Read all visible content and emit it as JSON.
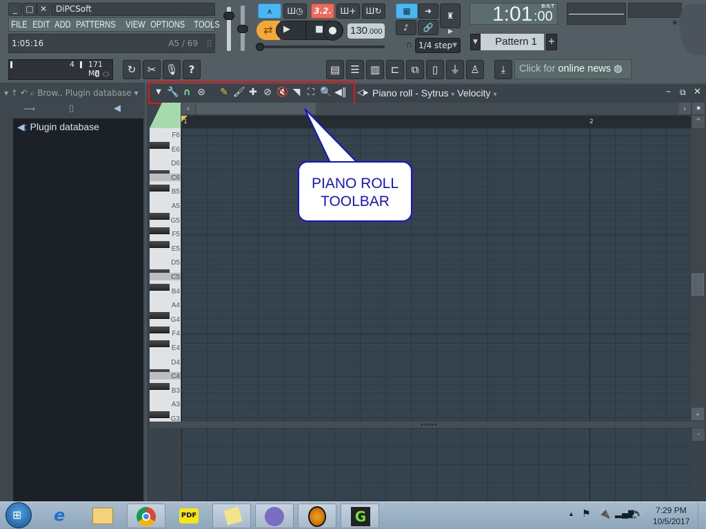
{
  "window": {
    "title": "DiPCSoft",
    "controls": [
      "minimize",
      "maximize",
      "close"
    ]
  },
  "menu": [
    "FILE",
    "EDIT",
    "ADD",
    "PATTERNS",
    "VIEW",
    "OPTIONS",
    "TOOLS",
    "?"
  ],
  "hint_bar": {
    "time": "1:05:16",
    "note_info": "A5 / 69"
  },
  "transport": {
    "song_position_mode": "3.2.",
    "tempo": "130",
    "tempo_decimal": ".000",
    "snap": "1/4 step",
    "pattern": "Pattern 1",
    "clock": {
      "main": "1:01",
      "sub": ":00",
      "format": "B:S:T"
    }
  },
  "system": {
    "cpu_value": "4",
    "memory": "171 MB",
    "polyphony": "0"
  },
  "news": {
    "prefix": "Click for",
    "link": "online news"
  },
  "browser": {
    "header_short": "Brow..",
    "header_title": "Plugin database",
    "items": [
      "Plugin database"
    ]
  },
  "piano_roll": {
    "title": "Piano roll - Sytrus",
    "target": "Velocity",
    "timeline_markers": [
      "1",
      "2"
    ],
    "keys": [
      {
        "label": "F6",
        "pos": 0
      },
      {
        "label": "E6",
        "pos": 1
      },
      {
        "label": "D6",
        "pos": 2
      },
      {
        "label": "C6",
        "pos": 3
      },
      {
        "label": "B5",
        "pos": 4
      },
      {
        "label": "A5",
        "pos": 5
      },
      {
        "label": "G5",
        "pos": 6
      },
      {
        "label": "F5",
        "pos": 7
      },
      {
        "label": "E5",
        "pos": 8
      },
      {
        "label": "D5",
        "pos": 9
      },
      {
        "label": "C5",
        "pos": 10
      },
      {
        "label": "B4",
        "pos": 11
      },
      {
        "label": "A4",
        "pos": 12
      },
      {
        "label": "G4",
        "pos": 13
      },
      {
        "label": "F4",
        "pos": 14
      },
      {
        "label": "E4",
        "pos": 15
      },
      {
        "label": "D4",
        "pos": 16
      },
      {
        "label": "C4",
        "pos": 17
      },
      {
        "label": "B3",
        "pos": 18
      },
      {
        "label": "A3",
        "pos": 19
      },
      {
        "label": "G3",
        "pos": 20
      }
    ],
    "toolbar_tools": [
      "options-menu",
      "wrench",
      "magnet",
      "playback",
      "draw",
      "paint",
      "paint-add",
      "delete",
      "mute",
      "slice",
      "select",
      "zoom",
      "playback-slide"
    ]
  },
  "annotation": {
    "line1": "PIANO ROLL",
    "line2": "TOOLBAR",
    "color": "#1212d6",
    "box_color": "#e11111"
  },
  "taskbar": {
    "apps": [
      "Start",
      "Internet Explorer",
      "File Explorer",
      "Google Chrome",
      "PDF",
      "Sticky Notes",
      "BitTorrent",
      "FL Studio",
      "Green App"
    ],
    "time": "7:29 PM",
    "date": "10/5/2017"
  }
}
